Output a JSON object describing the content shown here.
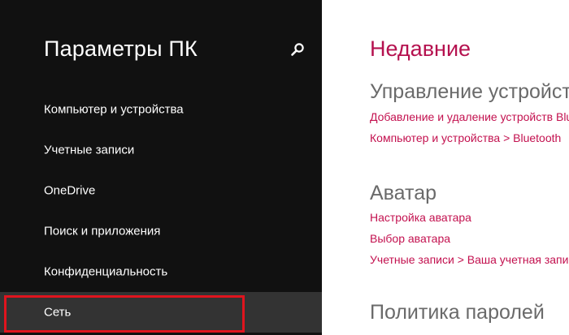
{
  "sidebar": {
    "title": "Параметры ПК",
    "search_icon": "search-icon",
    "items": [
      {
        "label": "Компьютер и устройства"
      },
      {
        "label": "Учетные записи"
      },
      {
        "label": "OneDrive"
      },
      {
        "label": "Поиск и приложения"
      },
      {
        "label": "Конфиденциальность"
      },
      {
        "label": "Сеть",
        "selected": true
      }
    ]
  },
  "content": {
    "heading": "Недавние",
    "sections": [
      {
        "title": "Управление устройствами",
        "links": [
          "Добавление и удаление устройств Bluetooth",
          "Компьютер и устройства > Bluetooth"
        ]
      },
      {
        "title": "Аватар",
        "links": [
          "Настройка аватара",
          "Выбор аватара",
          "Учетные записи > Ваша учетная запись"
        ]
      },
      {
        "title": "Политика паролей",
        "links": []
      }
    ]
  },
  "colors": {
    "sidebar_bg": "#111111",
    "selected_item_bg": "#333333",
    "accent": "#b5114f",
    "link": "#c3114f",
    "section_title": "#6a6a6a",
    "highlight_border": "#e0141e"
  }
}
